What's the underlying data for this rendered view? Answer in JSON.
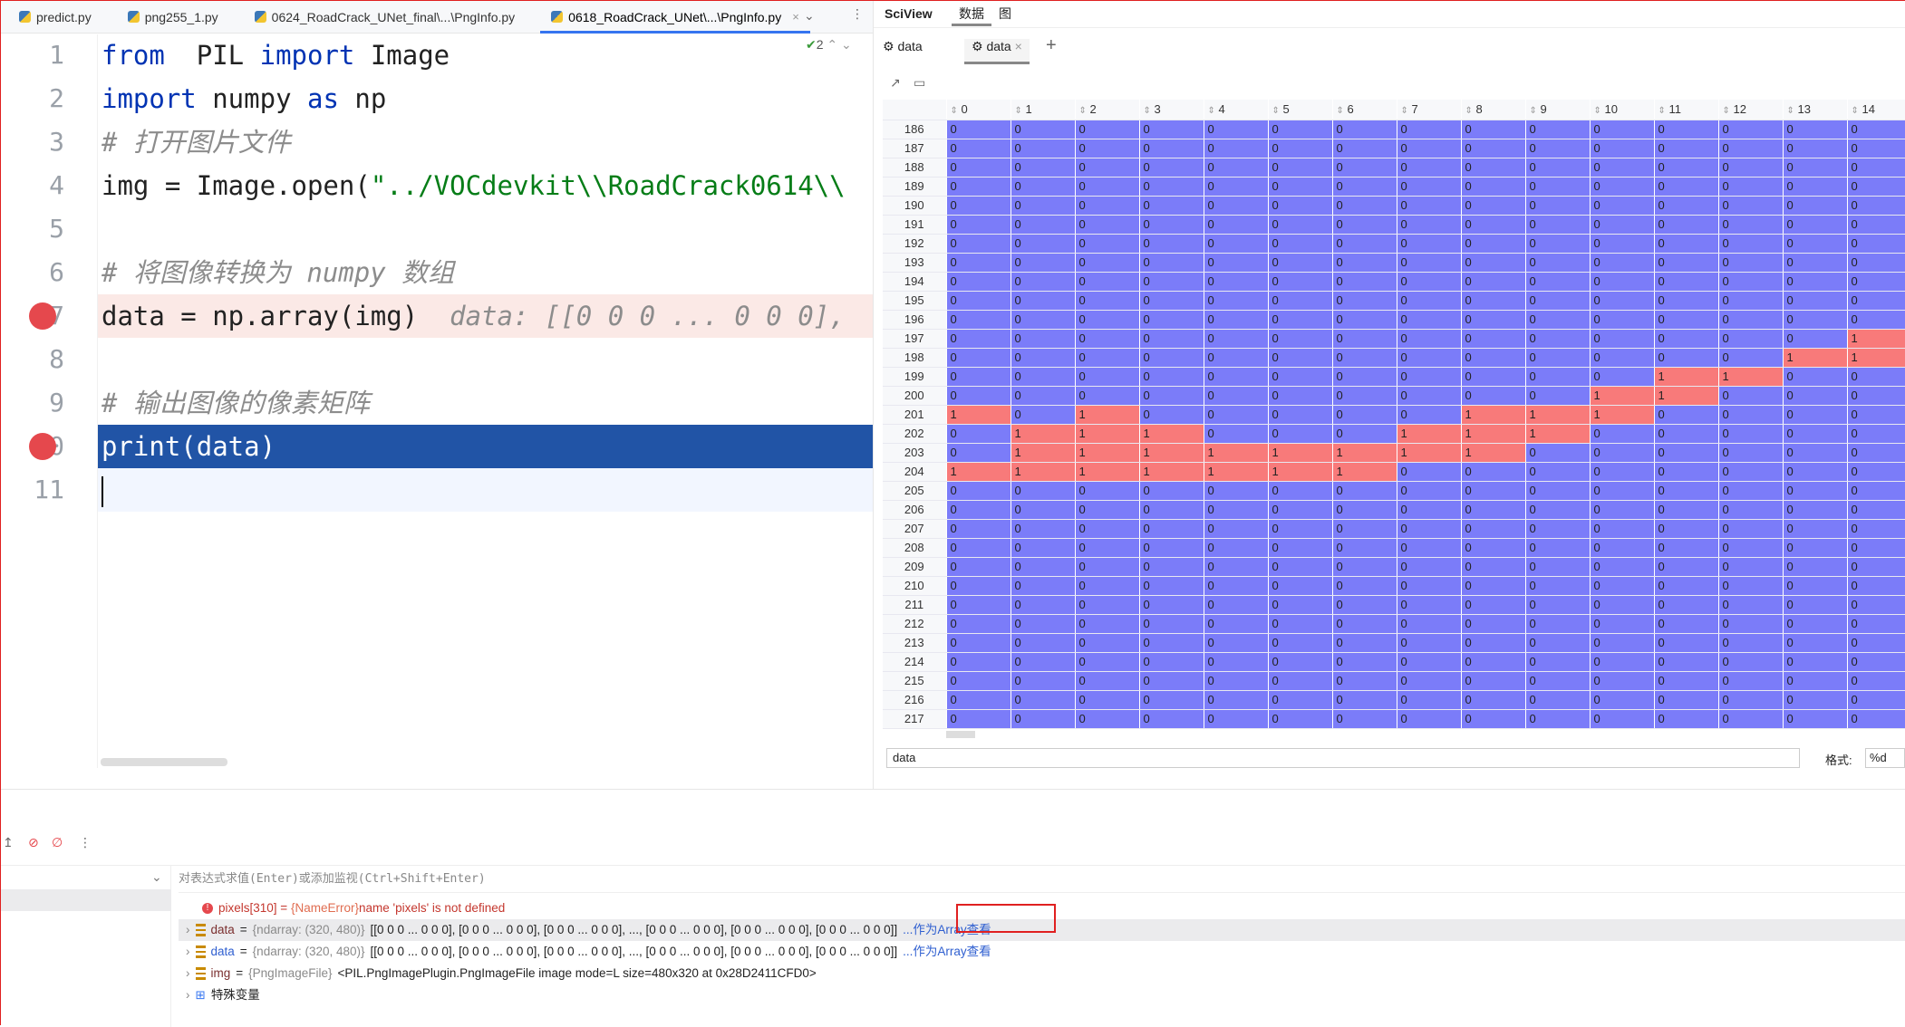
{
  "tabs": [
    {
      "label": "predict.py"
    },
    {
      "label": "png255_1.py"
    },
    {
      "label": "0624_RoadCrack_UNet_final\\...\\PngInfo.py"
    },
    {
      "label": "0618_RoadCrack_UNet\\...\\PngInfo.py",
      "active": true
    }
  ],
  "editor": {
    "inspections": "2",
    "lines": [
      {
        "n": "1",
        "parts": [
          [
            "kw",
            "from"
          ],
          [
            "",
            "  PIL "
          ],
          [
            "kw",
            "import"
          ],
          [
            "",
            " Image"
          ]
        ]
      },
      {
        "n": "2",
        "parts": [
          [
            "kw",
            "import"
          ],
          [
            "",
            " numpy "
          ],
          [
            "kw",
            "as"
          ],
          [
            "",
            " np"
          ]
        ]
      },
      {
        "n": "3",
        "parts": [
          [
            "cm",
            "# 打开图片文件"
          ]
        ]
      },
      {
        "n": "4",
        "parts": [
          [
            "",
            "img = Image.open("
          ],
          [
            "str",
            "\"../VOCdevkit\\\\RoadCrack0614\\\\"
          ]
        ]
      },
      {
        "n": "5",
        "parts": []
      },
      {
        "n": "6",
        "parts": [
          [
            "cm",
            "# 将图像转换为 numpy 数组"
          ]
        ]
      },
      {
        "n": "7",
        "parts": [
          [
            "",
            "data = np.array(img)  "
          ],
          [
            "hint",
            "data: [[0 0 0 ... 0 0 0],"
          ]
        ],
        "breakpoint": true
      },
      {
        "n": "8",
        "parts": []
      },
      {
        "n": "9",
        "parts": [
          [
            "cm",
            "# 输出图像的像素矩阵"
          ]
        ]
      },
      {
        "n": "10",
        "parts": [
          [
            "",
            "print(data)"
          ]
        ],
        "breakpoint": true,
        "selected": true
      },
      {
        "n": "11",
        "parts": [],
        "current": true
      }
    ]
  },
  "sciview": {
    "title": "SciView",
    "tab_data": "数据",
    "tab_plot": "图",
    "subtabs": [
      "data",
      "data"
    ],
    "add": "+",
    "columns": [
      "0",
      "1",
      "2",
      "3",
      "4",
      "5",
      "6",
      "7",
      "8",
      "9",
      "10",
      "11",
      "12",
      "13",
      "14"
    ],
    "row_start": 186,
    "rows": {
      "197": [
        14
      ],
      "198": [
        13,
        14
      ],
      "199": [
        11,
        12
      ],
      "200": [
        10,
        11
      ],
      "201": [
        0,
        2,
        8,
        9,
        10
      ],
      "202": [
        1,
        2,
        3,
        7,
        8,
        9
      ],
      "203": [
        1,
        2,
        3,
        4,
        5,
        6,
        7,
        8
      ],
      "204": [
        0,
        1,
        2,
        3,
        4,
        5,
        6
      ]
    },
    "row_count": 32,
    "colors": {
      "zero": "#7b7cf9",
      "one": "#f87a7a"
    },
    "slice_value": "data",
    "format_label": "格式:",
    "format_value": "%d"
  },
  "debug": {
    "expr_placeholder": "对表达式求值(Enter)或添加监视(Ctrl+Shift+Enter)",
    "vars": [
      {
        "name": "pixels[310]",
        "eq": " = ",
        "type": "{NameError}",
        "value": "name 'pixels' is not defined",
        "error": true
      },
      {
        "name": "data",
        "eq": " = ",
        "type": "{ndarray: (320, 480)}",
        "value": "[[0 0 0 ... 0 0 0], [0 0 0 ... 0 0 0], [0 0 0 ... 0 0 0], ..., [0 0 0 ... 0 0 0], [0 0 0 ... 0 0 0], [0 0 0 ... 0 0 0]]",
        "link": "...作为Array查看"
      },
      {
        "name": "data",
        "eq": " = ",
        "type": "{ndarray: (320, 480)}",
        "value": "[[0 0 0 ... 0 0 0], [0 0 0 ... 0 0 0], [0 0 0 ... 0 0 0], ..., [0 0 0 ... 0 0 0], [0 0 0 ... 0 0 0], [0 0 0 ... 0 0 0]]",
        "link": "...作为Array查看"
      },
      {
        "name": "img",
        "eq": " = ",
        "type": "{PngImageFile}",
        "value": "<PIL.PngImagePlugin.PngImageFile image mode=L size=480x320 at 0x28D2411CFD0>"
      },
      {
        "name": "特殊变量",
        "special": true
      }
    ]
  }
}
